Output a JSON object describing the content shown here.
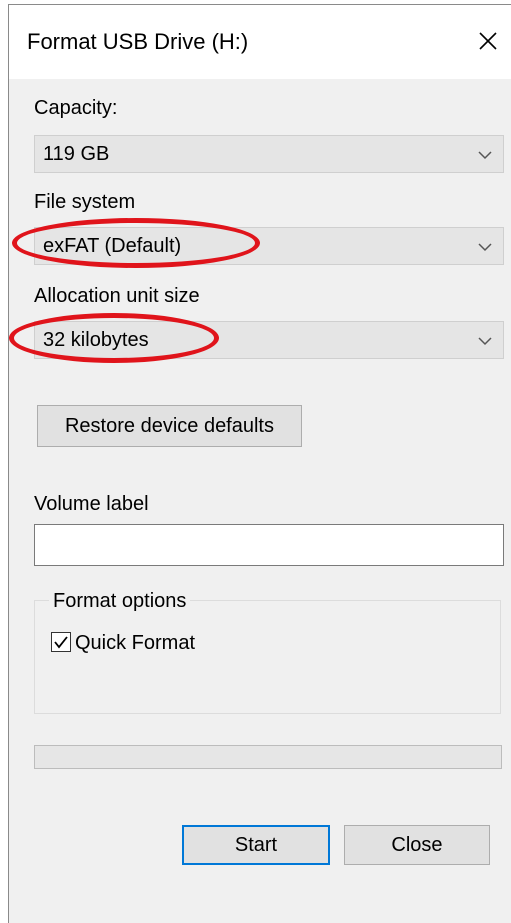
{
  "window": {
    "title": "Format USB Drive (H:)"
  },
  "capacity": {
    "label": "Capacity:",
    "selected": "119 GB"
  },
  "file_system": {
    "label": "File system",
    "selected": "exFAT (Default)"
  },
  "allocation": {
    "label": "Allocation unit size",
    "selected": "32 kilobytes"
  },
  "restore_button": {
    "label": "Restore device defaults"
  },
  "volume_label": {
    "label": "Volume label",
    "value": ""
  },
  "format_options": {
    "title": "Format options",
    "quick_format": {
      "label": "Quick Format",
      "checked": true
    }
  },
  "progress": {
    "value": 0
  },
  "buttons": {
    "start": "Start",
    "close": "Close"
  },
  "icons": {
    "close": "close-icon",
    "dropdown": "chevron-down-icon",
    "check": "checkmark-icon"
  },
  "colors": {
    "annotation": "#e0141b",
    "accent": "#0078d7"
  }
}
